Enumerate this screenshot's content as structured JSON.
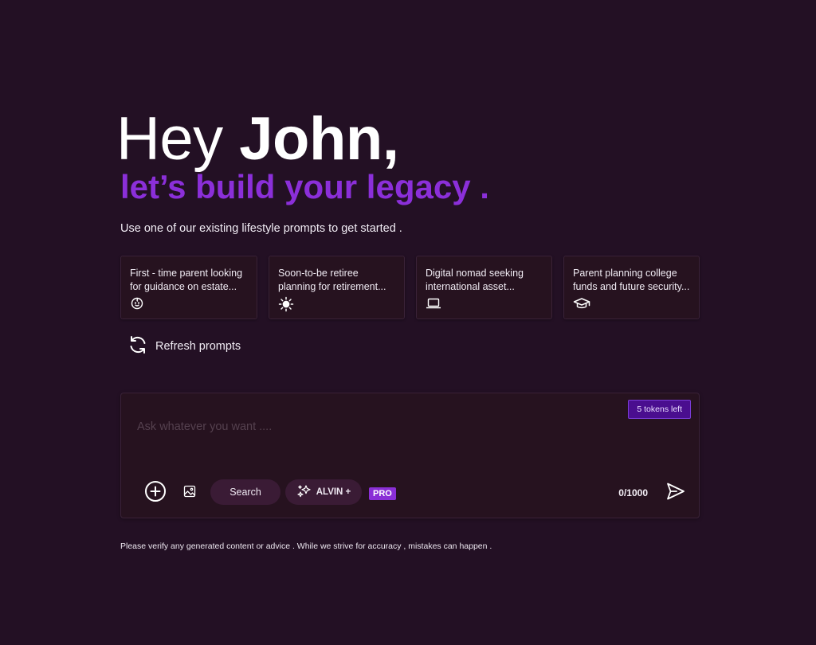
{
  "greeting": {
    "prefix": "Hey ",
    "name": "John,"
  },
  "tagline": "let’s build your legacy .",
  "intro": "Use one of our existing lifestyle prompts to get started .",
  "prompts": [
    {
      "text": "First - time parent looking\nfor guidance on estate...",
      "icon": "baby-face-icon"
    },
    {
      "text": "Soon-to-be retiree\nplanning for retirement...",
      "icon": "sun-icon"
    },
    {
      "text": "Digital nomad seeking\ninternational asset...",
      "icon": "laptop-icon"
    },
    {
      "text": "Parent planning college\nfunds and future security...",
      "icon": "graduation-cap-icon"
    }
  ],
  "refresh": {
    "label": "Refresh prompts",
    "icon": "refresh-icon"
  },
  "composer": {
    "tokens_label": "5 tokens left",
    "placeholder": "Ask whatever you want ....",
    "value": "",
    "search_label": "Search",
    "alvin_label": "ALVIN +",
    "pro_badge": "PRO",
    "counter": "0/1000",
    "icons": [
      "add-circle-icon",
      "image-icon",
      "sparkles-icon",
      "send-icon"
    ]
  },
  "disclaimer": "Please verify any generated content or advice . While we strive for accuracy , mistakes can happen .",
  "colors": {
    "background": "#231024",
    "accent": "#8b2fd9",
    "card": "#26121f",
    "pill": "#3a1b35"
  }
}
